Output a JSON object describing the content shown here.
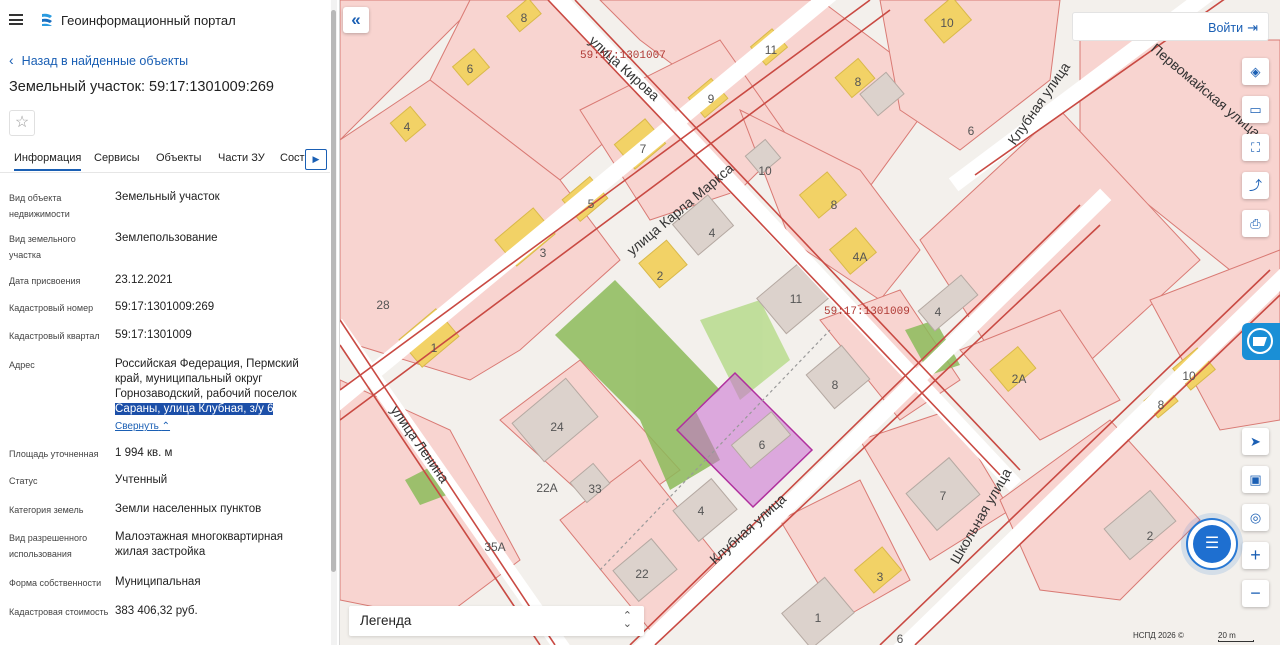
{
  "app": {
    "title": "Геоинформационный портал"
  },
  "panel": {
    "back_label": "Назад в найденные объекты",
    "object_title": "Земельный участок: 59:17:1301009:269",
    "tabs": [
      "Информация",
      "Сервисы",
      "Объекты",
      "Части ЗУ",
      "Соста"
    ],
    "properties": [
      {
        "label": "Вид объекта недвижимости",
        "value": "Земельный участок"
      },
      {
        "label": "Вид земельного участка",
        "value": "Землепользование"
      },
      {
        "label": "Дата присвоения",
        "value": "23.12.2021"
      },
      {
        "label": "Кадастровый номер",
        "value": "59:17:1301009:269"
      },
      {
        "label": "Кадастровый квартал",
        "value": "59:17:1301009"
      },
      {
        "label": "Адрес",
        "value": "Российская Федерация, Пермский край, муниципальный округ Горнозаводский, рабочий поселок",
        "value_highlight": "Сараны, улица Клубная, з/у 6"
      },
      {
        "label": "Площадь уточненная",
        "value": "1 994 кв. м"
      },
      {
        "label": "Статус",
        "value": "Учтенный"
      },
      {
        "label": "Категория земель",
        "value": "Земли населенных пунктов"
      },
      {
        "label": "Вид разрешенного использования",
        "value": "Малоэтажная многоквартирная жилая застройка"
      },
      {
        "label": "Форма собственности",
        "value": "Муниципальная"
      },
      {
        "label": "Кадастровая стоимость",
        "value": "383 406,32 руб."
      }
    ],
    "collapse_label": "Свернуть"
  },
  "map": {
    "login_label": "Войти",
    "legend_label": "Легенда",
    "copyright": "НСПД 2026 ©",
    "scale_label": "20 m",
    "streets": [
      "улица Кирова",
      "улица Карла Маркса",
      "Клубная улица",
      "Первомайская улица",
      "улица Ленина",
      "Клубная улица",
      "Школьная улица"
    ],
    "quarter_labels": [
      "59:17:1301007",
      "59:17:1301009"
    ],
    "house_numbers": [
      "8",
      "10",
      "11",
      "6",
      "9",
      "4",
      "7",
      "8",
      "6",
      "5",
      "10",
      "8",
      "3",
      "4",
      "4А",
      "2",
      "28",
      "11",
      "1",
      "4",
      "2А",
      "10",
      "8",
      "8",
      "24",
      "6",
      "22А",
      "33",
      "7",
      "4",
      "35А",
      "22",
      "3",
      "1",
      "6",
      "2"
    ],
    "colors": {
      "accent": "#1a5fb4",
      "parcel": "#c04040",
      "selected_parcel": "#b0309e",
      "building": "#f2d266",
      "vegetation": "#8cbb5a"
    },
    "tools": [
      "layers-icon",
      "ruler-icon",
      "select-area-icon",
      "share-icon",
      "print-icon",
      "locate-icon",
      "minimap-icon",
      "gps-icon",
      "zoom-in-icon",
      "zoom-out-icon"
    ]
  }
}
